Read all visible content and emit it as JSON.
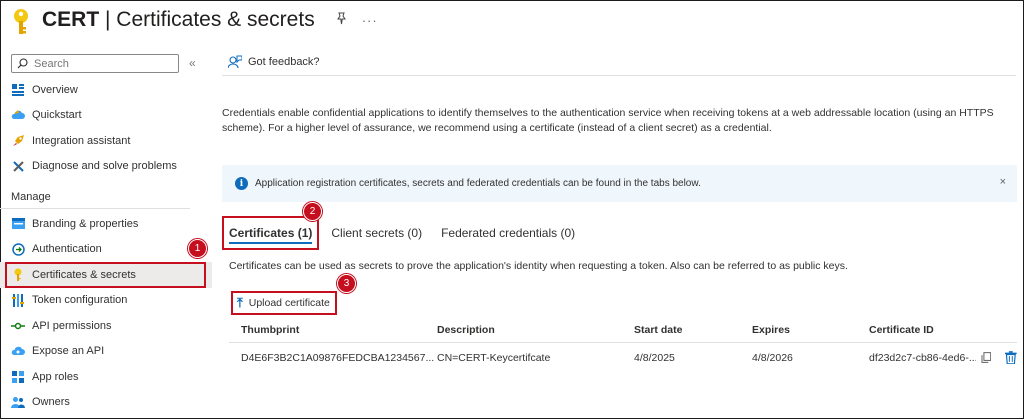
{
  "header": {
    "app_name": "CERT",
    "separator": " | ",
    "page_title": "Certificates & secrets",
    "more_glyph": "···"
  },
  "sidebar": {
    "search_placeholder": "Search",
    "collapse_glyph": "«",
    "items": [
      {
        "label": "Overview",
        "icon": "overview-icon"
      },
      {
        "label": "Quickstart",
        "icon": "cloud-icon"
      },
      {
        "label": "Integration assistant",
        "icon": "rocket-icon"
      },
      {
        "label": "Diagnose and solve problems",
        "icon": "wrench-icon"
      }
    ],
    "section_manage": "Manage",
    "manage_items": [
      {
        "label": "Branding & properties",
        "icon": "branding-icon"
      },
      {
        "label": "Authentication",
        "icon": "authentication-icon"
      },
      {
        "label": "Certificates & secrets",
        "icon": "key-icon",
        "selected": true
      },
      {
        "label": "Token configuration",
        "icon": "token-icon"
      },
      {
        "label": "API permissions",
        "icon": "api-permissions-icon"
      },
      {
        "label": "Expose an API",
        "icon": "cloud-expose-icon"
      },
      {
        "label": "App roles",
        "icon": "app-roles-icon"
      },
      {
        "label": "Owners",
        "icon": "owners-icon"
      }
    ]
  },
  "toolbar": {
    "feedback_label": "Got feedback?"
  },
  "main": {
    "description": "Credentials enable confidential applications to identify themselves to the authentication service when receiving tokens at a web addressable location (using an HTTPS scheme). For a higher level of assurance, we recommend using a certificate (instead of a client secret) as a credential.",
    "info_text": "Application registration certificates, secrets and federated credentials can be found in the tabs below.",
    "close_glyph": "×",
    "tabs": [
      {
        "label": "Certificates (1)",
        "active": true
      },
      {
        "label": "Client secrets (0)"
      },
      {
        "label": "Federated credentials (0)"
      }
    ],
    "tab_description": "Certificates can be used as secrets to prove the application's identity when requesting a token. Also can be referred to as public keys.",
    "upload_label": "Upload certificate",
    "upload_glyph": "⤒",
    "table": {
      "headers": [
        "Thumbprint",
        "Description",
        "Start date",
        "Expires",
        "Certificate ID"
      ],
      "rows": [
        [
          "D4E6F3B2C1A09876FEDCBA1234567...",
          "CN=CERT-Keycertifcate",
          "4/8/2025",
          "4/8/2026",
          "df23d2c7-cb86-4ed6-..."
        ]
      ]
    }
  },
  "annotations": [
    "1",
    "2",
    "3"
  ],
  "colors": {
    "accent": "#0f6cbd",
    "highlight": "#c50f1f",
    "key_yellow": "#f2c811"
  }
}
